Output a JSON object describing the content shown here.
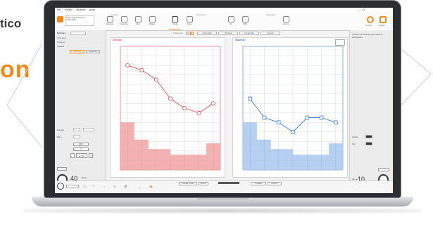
{
  "promo": {
    "word_top": "tico",
    "word_big": "on"
  },
  "app": {
    "menu": [
      "File",
      "Archivo",
      "Opciones",
      "Ayuda"
    ],
    "patient": {
      "line1": "Montserrat Martínez G.",
      "line2": "01/01/1980"
    },
    "ribbon_groups": [
      "Pruebas",
      "Audiometría",
      "Resultados"
    ],
    "ribbon_buttons": [
      "Paciente",
      "Otoscopia",
      "Timp.",
      "Reflejo",
      "Tonal",
      "Vocal",
      "HL",
      "ABR",
      "Informe"
    ],
    "right_ribbon": [
      "Conectar",
      "Guardar"
    ]
  },
  "left_panel": {
    "title": "Estímulo",
    "rows": [
      "Tono puro",
      "Continuo",
      "Pulsado"
    ],
    "tabs": [
      "Derecho",
      "Izquierdo"
    ],
    "lower_rows": [
      "Enmasc.",
      "Paso"
    ],
    "values": [
      "NBN",
      "0",
      "1.54"
    ],
    "knob_value": "40",
    "knob_label": "dB HL"
  },
  "right_panel": {
    "info": "Arrastre los símbolos para editar el audiograma",
    "toggles": [
      "Sonido",
      "Voz"
    ],
    "knob_value": "-10",
    "knob_label": "dB"
  },
  "chart_toolbar": {
    "label": "Transductor",
    "buttons": [
      "Auriculares",
      "Vía ósea",
      "Campo libre",
      "Insertos"
    ],
    "sep_buttons": [
      "A",
      "B"
    ]
  },
  "bottom_bar": {
    "buttons": [
      "Guardar prueba",
      "Borrar"
    ],
    "right_buttons": [
      "Comparar",
      "Imprimir"
    ]
  },
  "ears": {
    "right": {
      "label": "Derecho",
      "color": "#e14b4b",
      "fill": "#f2a3a3"
    },
    "left": {
      "label": "Izquierdo",
      "color": "#3b7fd6",
      "fill": "#a9c8f0"
    }
  },
  "chart_data": [
    {
      "type": "line",
      "title": "",
      "x": [
        125,
        250,
        500,
        1000,
        2000,
        4000,
        8000
      ],
      "series": [
        {
          "name": "",
          "values": [
            10,
            15,
            25,
            45,
            55,
            60,
            50
          ]
        }
      ],
      "ylim": [
        -10,
        120
      ],
      "grid": true
    },
    {
      "type": "line",
      "title": "",
      "x": [
        125,
        250,
        500,
        1000,
        2000,
        4000,
        8000
      ],
      "series": [
        {
          "name": "",
          "values": [
            45,
            65,
            70,
            80,
            65,
            65,
            70
          ]
        }
      ],
      "ylim": [
        -10,
        120
      ],
      "grid": true
    }
  ]
}
